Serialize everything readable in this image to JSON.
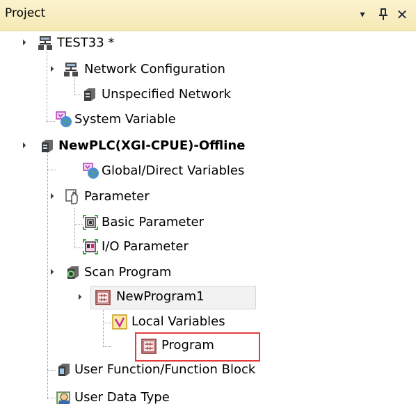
{
  "panel": {
    "title": "Project",
    "menu_glyph": "▾",
    "pin_glyph": "ᵖ",
    "close_glyph": "✕"
  },
  "tree": {
    "root": {
      "label": "TEST33 *",
      "icon": "project-network-icon"
    },
    "network_config": {
      "label": "Network Configuration",
      "icon": "network-icon"
    },
    "unspecified_network": {
      "label": "Unspecified Network",
      "icon": "plc-module-icon"
    },
    "system_variable": {
      "label": "System Variable",
      "icon": "global-variable-icon"
    },
    "plc": {
      "label": "NewPLC(XGI-CPUE)-Offline",
      "icon": "plc-module-icon"
    },
    "global_vars": {
      "label": "Global/Direct Variables",
      "icon": "global-variable-icon"
    },
    "parameter": {
      "label": "Parameter",
      "icon": "parameter-hand-icon"
    },
    "basic_param": {
      "label": "Basic Parameter",
      "icon": "basic-parameter-icon"
    },
    "io_param": {
      "label": "I/O Parameter",
      "icon": "io-parameter-icon"
    },
    "scan_program": {
      "label": "Scan Program",
      "icon": "scan-program-icon"
    },
    "new_program": {
      "label": "NewProgram1",
      "icon": "ladder-program-icon"
    },
    "local_vars": {
      "label": "Local Variables",
      "icon": "local-variables-icon"
    },
    "program": {
      "label": "Program",
      "icon": "ladder-program-icon"
    },
    "user_fb": {
      "label": "User Function/Function Block",
      "icon": "function-block-icon"
    },
    "user_data_type": {
      "label": "User Data Type",
      "icon": "data-type-icon"
    }
  },
  "colors": {
    "header_bg": "#f6e9b5",
    "highlight_box": "#e23b3b",
    "selection_bg": "#f2f2f2"
  }
}
